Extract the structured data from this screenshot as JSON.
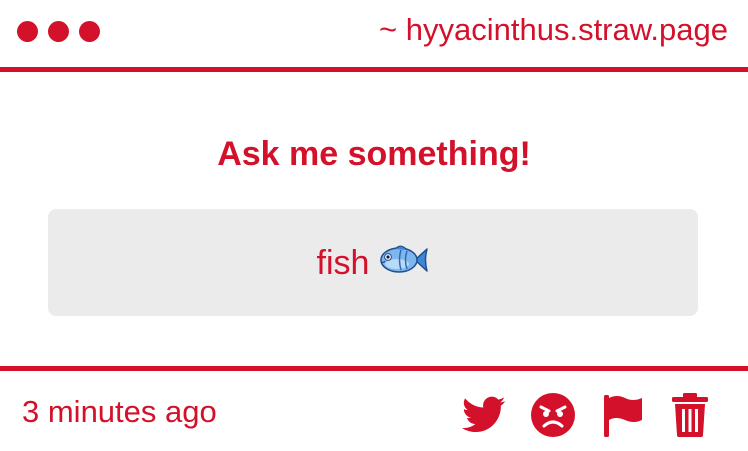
{
  "header": {
    "site_url": "~ hyyacinthus.straw.page",
    "window_dots": [
      "red",
      "red",
      "red"
    ]
  },
  "main": {
    "prompt": "Ask me something!",
    "answer": {
      "text": "fish",
      "emoji": "fish-icon"
    }
  },
  "footer": {
    "timestamp": "3 minutes ago",
    "actions": [
      {
        "name": "twitter-share",
        "icon": "twitter-bird-icon"
      },
      {
        "name": "angry-reaction",
        "icon": "angry-face-icon"
      },
      {
        "name": "report",
        "icon": "flag-icon"
      },
      {
        "name": "delete",
        "icon": "trash-icon"
      }
    ]
  },
  "colors": {
    "accent": "#d3112a",
    "answer_bg": "#ecebec",
    "background": "#ffffff"
  }
}
